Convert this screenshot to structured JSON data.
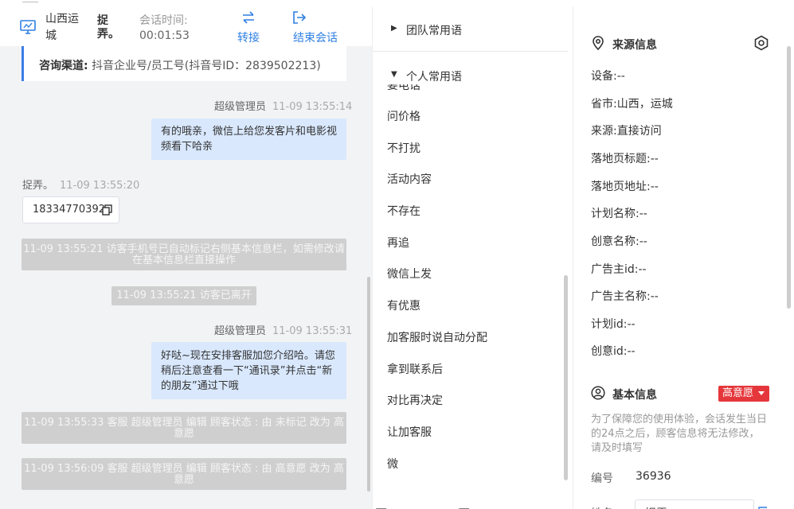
{
  "header": {
    "region": "山西运城",
    "visitor_name": "捉弄。",
    "time_label": "会话时间:",
    "time_value": "00:01:53",
    "transfer_label": "转接",
    "end_label": "结束会话"
  },
  "chat": {
    "channel_label": "咨询渠道:",
    "channel_value": "抖音企业号/员工号(抖音号ID：2839502213)",
    "messages": [
      {
        "sender": "超级管理员",
        "time": "11-09 13:55:14",
        "text": "有的哦亲，微信上给您发客片和电影视频看下哈亲"
      },
      {
        "sender": "捉弄。",
        "time": "11-09 13:55:20",
        "phone": "18334770392"
      },
      {
        "system": "11-09 13:55:21 访客手机号已自动标记右侧基本信息栏，如需修改请在基本信息栏直接操作"
      },
      {
        "system": "11-09 13:55:21 访客已离开"
      },
      {
        "sender": "超级管理员",
        "time": "11-09 13:55:31",
        "text": "好哒~现在安排客服加您介绍哈。请您稍后注意查看一下“通讯录”并点击“新的朋友”通过下哦"
      },
      {
        "system": "11-09 13:55:33 客服 超级管理员 编辑 顾客状态 : 由 未标记 改为 高意愿"
      },
      {
        "system": "11-09 13:56:09 客服 超级管理员 编辑 顾客状态 : 由 高意愿 改为 高意愿"
      }
    ]
  },
  "phrases": {
    "team_group": "团队常用语",
    "personal_group": "个人常用语",
    "partial_item": "要电话",
    "items": [
      "问价格",
      "不打扰",
      "活动内容",
      "不存在",
      "再追",
      "微信上发",
      "有优惠",
      "加客服时说自动分配",
      "拿到联系后",
      "对比再决定",
      "让加客服",
      "微"
    ]
  },
  "info": {
    "source_title": "来源信息",
    "source_rows": [
      {
        "label": "设备:",
        "value": "--"
      },
      {
        "label": "省市:",
        "value": "山西，运城"
      },
      {
        "label": "来源:",
        "value": "直接访问"
      },
      {
        "label": "落地页标题:",
        "value": "--"
      },
      {
        "label": "落地页地址:",
        "value": "--"
      },
      {
        "label": "计划名称:",
        "value": "--"
      },
      {
        "label": "创意名称:",
        "value": "--"
      },
      {
        "label": "广告主id:",
        "value": "--"
      },
      {
        "label": "广告主名称:",
        "value": "--"
      },
      {
        "label": "计划id:",
        "value": "--"
      },
      {
        "label": "创意id:",
        "value": "--"
      }
    ],
    "basic_title": "基本信息",
    "intent_tag": "高意愿",
    "notice": "为了保障您的使用体验，会话发生当日的24点之后，顾客信息将无法修改，请及时填写",
    "id_label": "编号",
    "id_value": "36936",
    "name_label": "姓名",
    "name_value": "捉弄"
  },
  "colors": {
    "accent": "#2f7fe3",
    "agent_bubble": "#d9e8fd",
    "system_msg": "#cfcfcf",
    "intent_tag": "#e5373b"
  }
}
